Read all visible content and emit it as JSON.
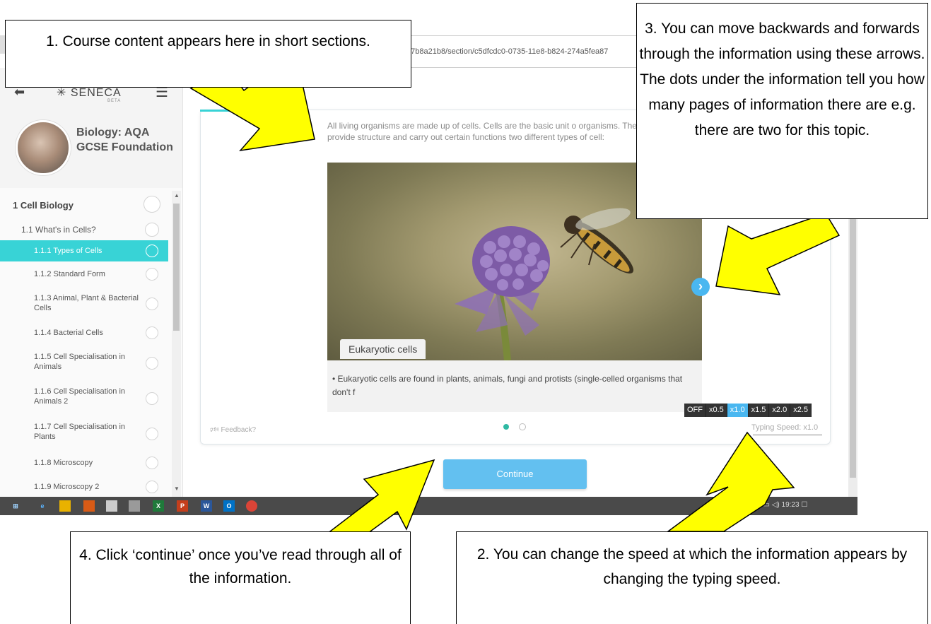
{
  "browser": {
    "url": "b7b8a21b8/section/c5dfcdc0-0735-11e8-b824-274a5fea87"
  },
  "sidebar": {
    "logo": "SENECA",
    "logo_beta": "BETA",
    "course_title": "Biology: AQA GCSE Foundation",
    "items": [
      {
        "label": "1 Cell Biology",
        "level": 0,
        "active": false
      },
      {
        "label": "1.1 What's in Cells?",
        "level": 1,
        "active": false
      },
      {
        "label": "1.1.1 Types of Cells",
        "level": 2,
        "active": true
      },
      {
        "label": "1.1.2 Standard Form",
        "level": 2,
        "active": false
      },
      {
        "label": "1.1.3 Animal, Plant & Bacterial Cells",
        "level": 2,
        "active": false
      },
      {
        "label": "1.1.4 Bacterial Cells",
        "level": 2,
        "active": false
      },
      {
        "label": "1.1.5 Cell Specialisation in Animals",
        "level": 2,
        "active": false
      },
      {
        "label": "1.1.6 Cell Specialisation in Animals 2",
        "level": 2,
        "active": false
      },
      {
        "label": "1.1.7 Cell Specialisation in Plants",
        "level": 2,
        "active": false
      },
      {
        "label": "1.1.8 Microscopy",
        "level": 2,
        "active": false
      },
      {
        "label": "1.1.9 Microscopy 2",
        "level": 2,
        "active": false
      }
    ]
  },
  "content": {
    "intro": "All living organisms are made up of cells. Cells are the basic unit o organisms. They provide structure and carry out certain functions two different types of cell:",
    "photo_tag": "Eukaryotic cells",
    "bullet": "Eukaryotic cells are found in plants, animals, fungi and protists (single-celled organisms that don't f",
    "feedback": "Feedback?",
    "speed_options": [
      "OFF",
      "x0.5",
      "x1.0",
      "x1.5",
      "x2.0",
      "x2.5"
    ],
    "speed_selected": "x1.0",
    "typing_speed": "Typing Speed: x1.0",
    "continue_label": "Continue",
    "pages_total": 2,
    "page_current": 1
  },
  "taskbar": {
    "tray_time": "19:23"
  },
  "callouts": {
    "c1": "1. Course content appears here in short sections.",
    "c2": "2. You can change the speed at which the information appears by changing the typing speed.",
    "c3": "3. You can move backwards and forwards through the information using these arrows. The dots under the information tell you how many pages of information there are e.g. there are two for this topic.",
    "c4": "4. Click ‘continue’ once you’ve read through all of the information."
  },
  "colors": {
    "accent_teal": "#38d3d6",
    "button_blue": "#63c0f0",
    "arrow_yellow": "#ffff00"
  }
}
